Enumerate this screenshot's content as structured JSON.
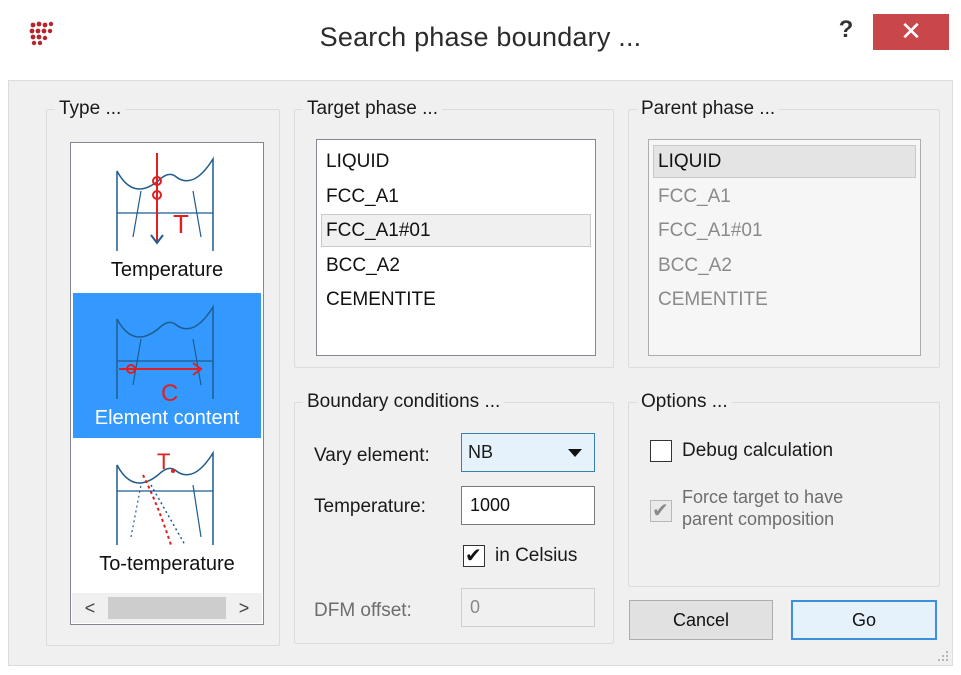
{
  "window": {
    "title": "Search  phase boundary ...",
    "help_label": "?",
    "close_label": "✕"
  },
  "type_group": {
    "legend": "Type ...",
    "items": [
      {
        "label": "Temperature",
        "selected": false
      },
      {
        "label": "Element content",
        "selected": true
      },
      {
        "label": "To-temperature",
        "selected": false
      }
    ],
    "scroll_left": "<",
    "scroll_right": ">"
  },
  "target_group": {
    "legend": "Target phase ...",
    "items": [
      "LIQUID",
      "FCC_A1",
      "FCC_A1#01",
      "BCC_A2",
      "CEMENTITE"
    ]
  },
  "parent_group": {
    "legend": "Parent phase ...",
    "items": [
      "LIQUID",
      "FCC_A1",
      "FCC_A1#01",
      "BCC_A2",
      "CEMENTITE"
    ]
  },
  "boundary_group": {
    "legend": "Boundary conditions ...",
    "vary_element_label": "Vary element:",
    "vary_element_value": "NB",
    "temperature_label": "Temperature:",
    "temperature_value": "1000",
    "in_celsius_label": "in Celsius",
    "in_celsius_checked": true,
    "dfm_offset_label": "DFM offset:",
    "dfm_offset_value": "0"
  },
  "options_group": {
    "legend": "Options ...",
    "debug_label": "Debug calculation",
    "debug_checked": false,
    "force_label_line1": "Force target to have",
    "force_label_line2": "parent composition",
    "force_checked": true
  },
  "buttons": {
    "cancel": "Cancel",
    "go": "Go"
  },
  "colors": {
    "selection": "#3399ff",
    "close_button": "#c9474a",
    "diagram_red": "#e02020",
    "diagram_blue": "#1f5c8f"
  }
}
